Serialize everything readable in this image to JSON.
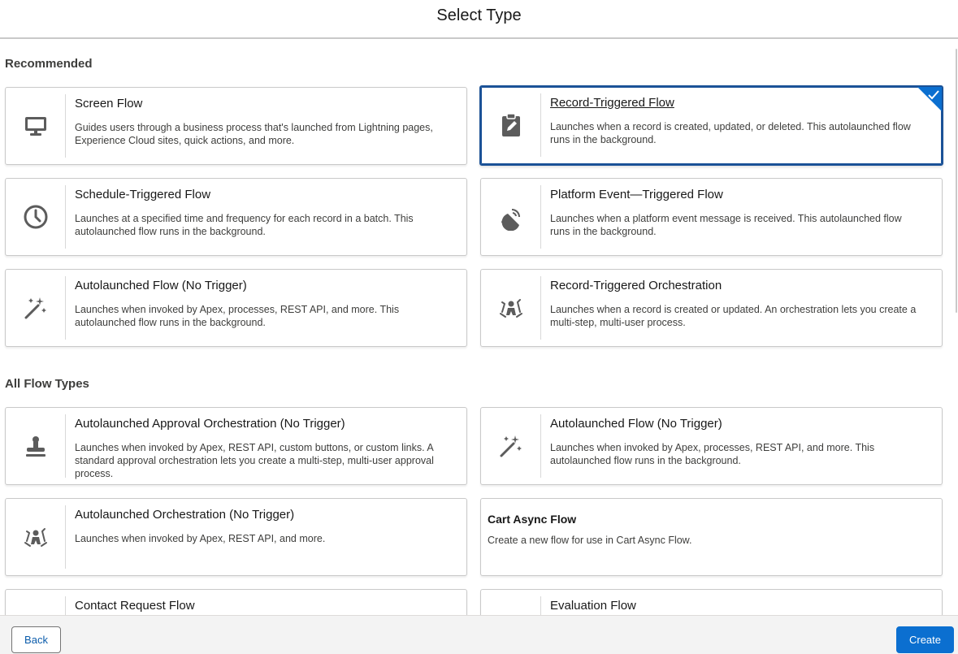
{
  "header": {
    "title": "Select Type"
  },
  "sections": {
    "recommended": "Recommended",
    "all": "All Flow Types"
  },
  "recommended": [
    {
      "title": "Screen Flow",
      "icon": "monitor-icon",
      "description": "Guides users through a business process that's launched from Lightning pages, Experience Cloud sites, quick actions, and more."
    },
    {
      "title": "Record-Triggered Flow",
      "icon": "clipboard-edit-icon",
      "description": "Launches when a record is created, updated, or deleted. This autolaunched flow runs in the background.",
      "selected": true
    },
    {
      "title": "Schedule-Triggered Flow",
      "icon": "clock-icon",
      "description": "Launches at a specified time and frequency for each record in a batch. This autolaunched flow runs in the background."
    },
    {
      "title": "Platform Event—Triggered Flow",
      "icon": "satellite-dish-icon",
      "description": "Launches when a platform event message is received. This autolaunched flow runs in the background."
    },
    {
      "title": "Autolaunched Flow (No Trigger)",
      "icon": "magic-wand-icon",
      "description": "Launches when invoked by Apex, processes, REST API, and more. This autolaunched flow runs in the background."
    },
    {
      "title": "Record-Triggered Orchestration",
      "icon": "orchestration-icon",
      "description": "Launches when a record is created or updated. An orchestration lets you create a multi-step, multi-user process."
    }
  ],
  "all_types": [
    {
      "title": "Autolaunched Approval Orchestration (No Trigger)",
      "icon": "stamp-icon",
      "description": "Launches when invoked by Apex, REST API, custom buttons, or custom links. A standard approval orchestration lets you create a multi-step, multi-user approval process."
    },
    {
      "title": "Autolaunched Flow (No Trigger)",
      "icon": "magic-wand-icon",
      "description": "Launches when invoked by Apex, processes, REST API, and more. This autolaunched flow runs in the background."
    },
    {
      "title": "Autolaunched Orchestration (No Trigger)",
      "icon": "orchestration-icon",
      "description": "Launches when invoked by Apex, REST API, and more."
    },
    {
      "title": "Cart Async Flow",
      "icon": "",
      "description": "Create a new flow for use in Cart Async Flow."
    },
    {
      "title": "Contact Request Flow",
      "icon": "",
      "description": ""
    },
    {
      "title": "Evaluation Flow",
      "icon": "",
      "description": ""
    }
  ],
  "footer": {
    "back_label": "Back",
    "create_label": "Create"
  },
  "colors": {
    "brand": "#0b6fd0",
    "selected_border": "#1b5297",
    "icon": "#5c5c5c"
  }
}
